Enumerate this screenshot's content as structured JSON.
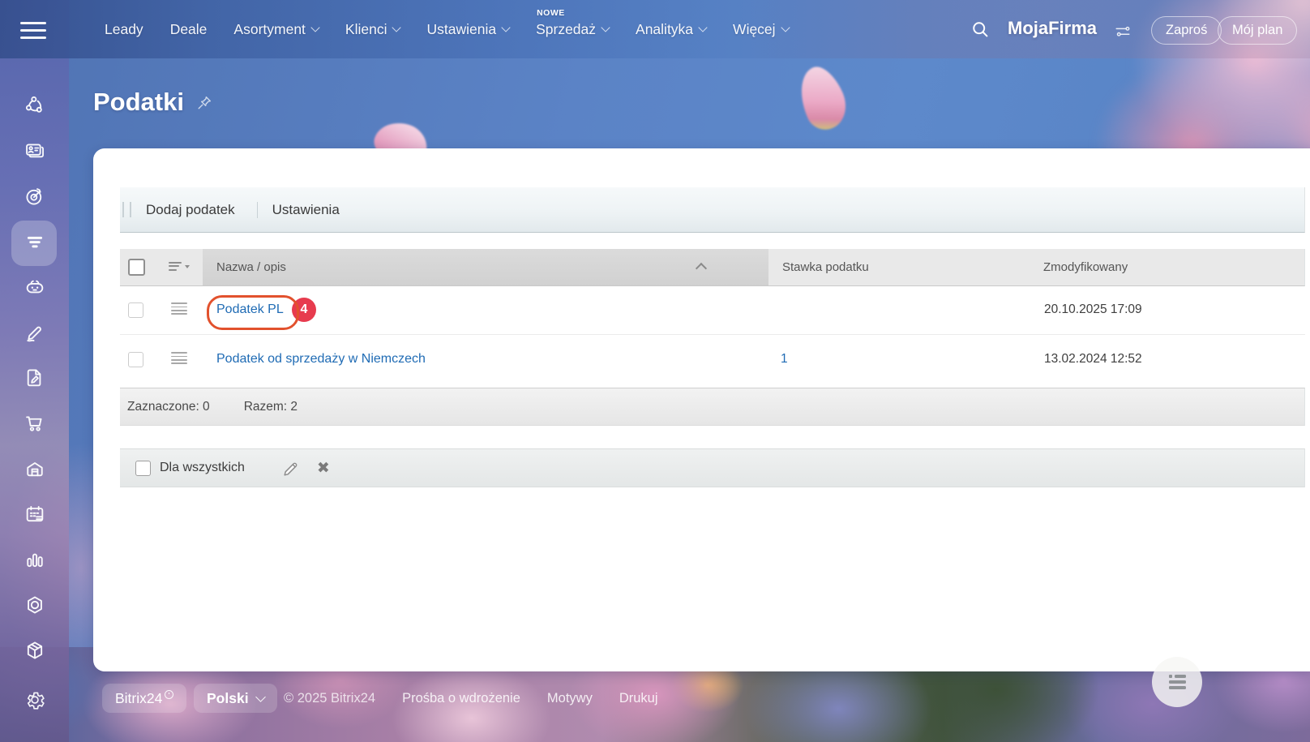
{
  "topbar": {
    "nav": [
      {
        "label": "Leady"
      },
      {
        "label": "Deale"
      },
      {
        "label": "Asortyment"
      },
      {
        "label": "Klienci"
      },
      {
        "label": "Ustawienia"
      },
      {
        "label": "Sprzedaż",
        "badge": "NOWE"
      },
      {
        "label": "Analityka"
      },
      {
        "label": "Więcej"
      }
    ],
    "nowe_badge": "NOWE",
    "account_name": "MojaFirma",
    "invite_label": "Zaproś",
    "plan_label": "Mój plan"
  },
  "sidebar": {
    "active_item": "crm-funnel",
    "items": [
      "share-network",
      "contact-card",
      "sales-target",
      "crm-funnel",
      "automation-robot",
      "sign-pen",
      "document-edit",
      "shopping-cart",
      "warehouse",
      "calendar-schedule",
      "bar-chart",
      "integrations-hexagon",
      "product-box",
      "settings-gear"
    ]
  },
  "page": {
    "title": "Podatki"
  },
  "toolbar": {
    "add_label": "Dodaj podatek",
    "settings_label": "Ustawienia"
  },
  "table": {
    "columns": [
      "Nazwa / opis",
      "Stawka podatku",
      "Zmodyfikowany"
    ],
    "rows": [
      {
        "name": "Podatek PL",
        "rate": "",
        "modified": "20.10.2025 17:09",
        "annotated": true,
        "badge": "4"
      },
      {
        "name": "Podatek od sprzedaży w Niemczech",
        "rate": "1",
        "modified": "13.02.2024 12:52",
        "annotated": false,
        "badge": ""
      }
    ],
    "selected_label": "Zaznaczone: 0",
    "total_label": "Razem: 2"
  },
  "bulk": {
    "label": "Dla wszystkich"
  },
  "footer": {
    "brand": "Bitrix24",
    "language": "Polski",
    "copyright": "© 2025 Bitrix24",
    "links": [
      "Prośba o wdrożenie",
      "Motywy",
      "Drukuj"
    ]
  },
  "colors": {
    "link_blue": "#1f6bb4",
    "annotation_outline": "#e2512d",
    "annotation_badge": "#e73b4e",
    "topbar_text": "#ffffff"
  }
}
